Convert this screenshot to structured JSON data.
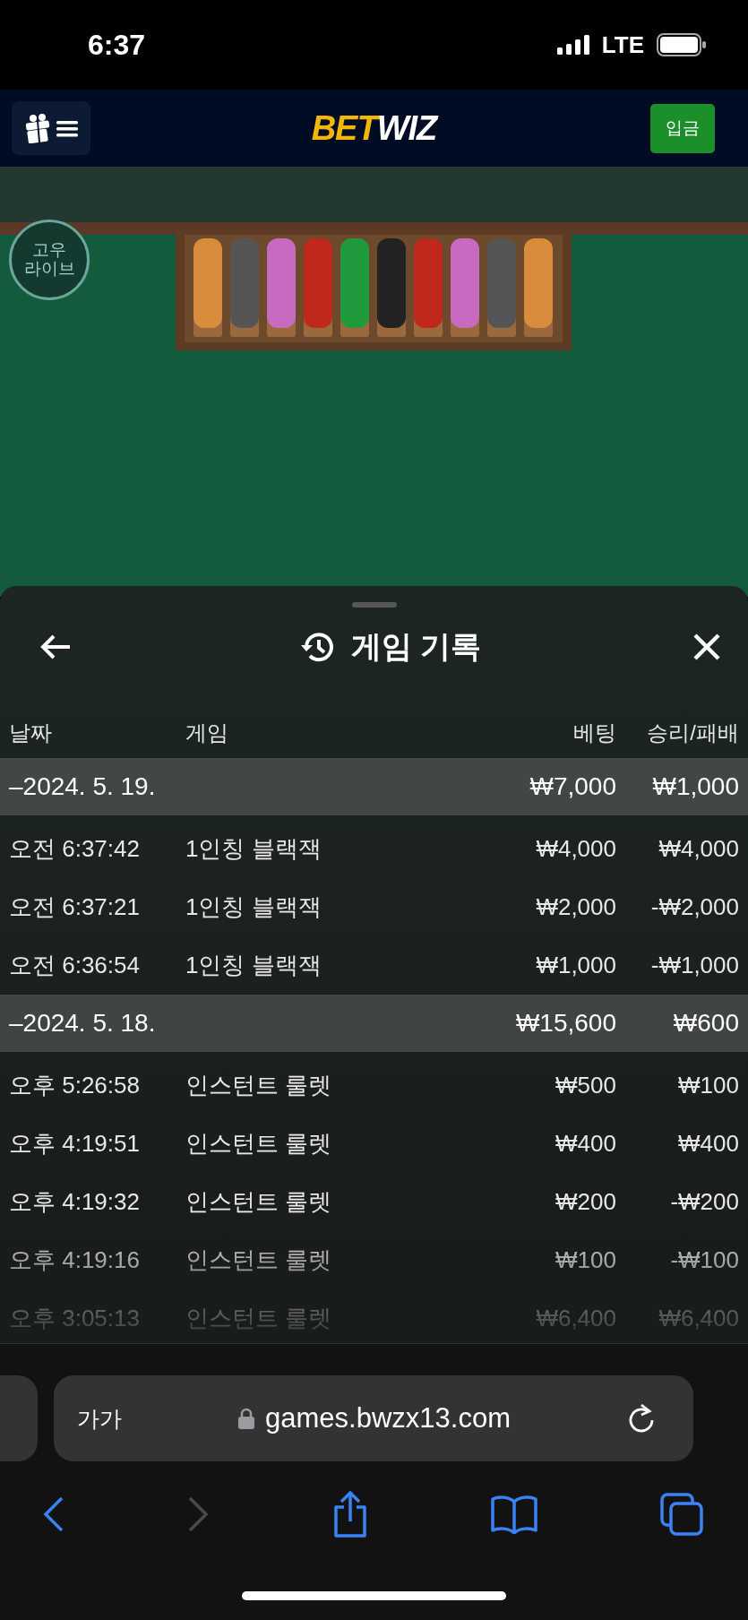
{
  "status_bar": {
    "time": "6:37",
    "network": "LTE"
  },
  "header": {
    "logo": [
      {
        "text": "BET",
        "color": "#f2b705"
      },
      {
        "text": "WIZ",
        "color": "#ffffff"
      }
    ],
    "deposit_button": "입금"
  },
  "live_badge": {
    "lines": [
      "고우",
      "라이브"
    ]
  },
  "history_panel": {
    "title": "게임 기록",
    "columns": [
      "날짜",
      "게임",
      "베팅",
      "승리/패배"
    ],
    "groups": [
      {
        "date": "–2024. 5. 19.",
        "bet": "₩7,000",
        "result": "₩1,000",
        "rows": [
          {
            "time": "오전 6:37:42",
            "game": "1인칭 블랙잭",
            "bet": "₩4,000",
            "result": "₩4,000"
          },
          {
            "time": "오전 6:37:21",
            "game": "1인칭 블랙잭",
            "bet": "₩2,000",
            "result": "-₩2,000"
          },
          {
            "time": "오전 6:36:54",
            "game": "1인칭 블랙잭",
            "bet": "₩1,000",
            "result": "-₩1,000"
          }
        ]
      },
      {
        "date": "–2024. 5. 18.",
        "bet": "₩15,600",
        "result": "₩600",
        "rows": [
          {
            "time": "오후 5:26:58",
            "game": "인스턴트 룰렛",
            "bet": "₩500",
            "result": "₩100"
          },
          {
            "time": "오후 4:19:51",
            "game": "인스턴트 룰렛",
            "bet": "₩400",
            "result": "₩400"
          },
          {
            "time": "오후 4:19:32",
            "game": "인스턴트 룰렛",
            "bet": "₩200",
            "result": "-₩200"
          },
          {
            "time": "오후 4:19:16",
            "game": "인스턴트 룰렛",
            "bet": "₩100",
            "result": "-₩100"
          },
          {
            "time": "오후 3:05:13",
            "game": "인스턴트 룰렛",
            "bet": "₩6,400",
            "result": "₩6,400"
          }
        ]
      }
    ]
  },
  "browser": {
    "text_size_button": "가가",
    "url": "games.bwzx13.com",
    "forward_disabled": true
  }
}
